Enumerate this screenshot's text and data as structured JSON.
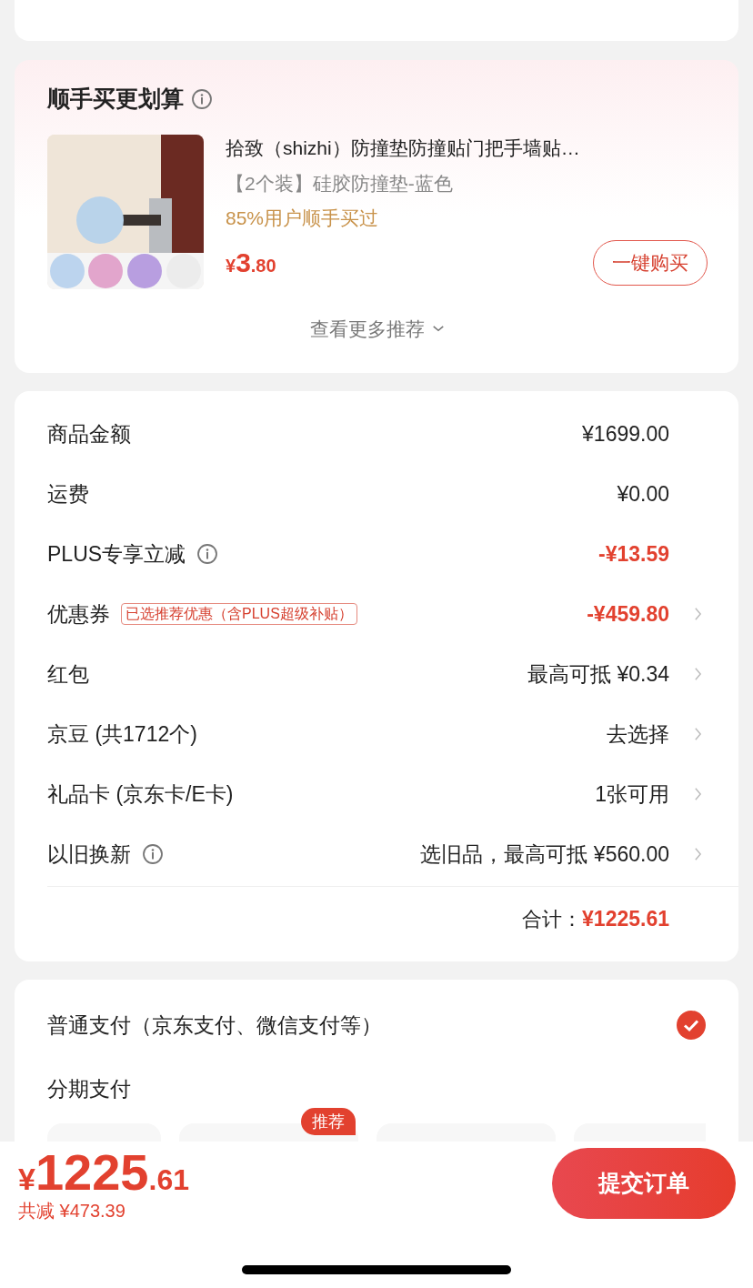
{
  "bundle": {
    "title": "顺手买更划算",
    "info": true,
    "product": {
      "title": "拾致（shizhi）防撞垫防撞贴门把手墙贴…",
      "spec": "【2个装】硅胶防撞垫-蓝色",
      "social": "85%用户顺手买过",
      "price": {
        "currency": "¥",
        "integer": "3",
        "decimal": ".80"
      },
      "button": "一键购买"
    },
    "more": "查看更多推荐"
  },
  "summary": {
    "rows": [
      {
        "label": "商品金额",
        "info": false,
        "value": "¥1699.00",
        "kind": "plain",
        "chevron": false
      },
      {
        "label": "运费",
        "info": false,
        "value": "¥0.00",
        "kind": "plain",
        "chevron": false
      },
      {
        "label": "PLUS专享立减",
        "info": true,
        "value": "-¥13.59",
        "kind": "discount",
        "chevron": false
      },
      {
        "label": "优惠券",
        "info": false,
        "tag": "已选推荐优惠（含PLUS超级补贴）",
        "value": "-¥459.80",
        "kind": "discount",
        "chevron": true
      },
      {
        "label": "红包",
        "info": false,
        "value": "最高可抵 ¥0.34",
        "kind": "plain",
        "chevron": true
      },
      {
        "label": "京豆 (共1712个)",
        "info": false,
        "value": "去选择",
        "kind": "plain",
        "chevron": true
      },
      {
        "label": "礼品卡 (京东卡/E卡)",
        "info": false,
        "value": "1张可用",
        "kind": "plain",
        "chevron": true
      },
      {
        "label": "以旧换新",
        "info": true,
        "value": "选旧品，最高可抵 ¥560.00",
        "kind": "plain",
        "chevron": true
      }
    ],
    "total_label": "合计：",
    "total_value": "¥1225.61"
  },
  "payment": {
    "options": [
      {
        "label": "普通支付（京东支付、微信支付等）",
        "selected": true
      }
    ],
    "installment": {
      "label": "分期支付",
      "badge": "推荐"
    }
  },
  "bottom_bar": {
    "price": {
      "currency": "¥",
      "integer": "1225",
      "decimal": ".61"
    },
    "saved": "共减 ¥473.39",
    "submit": "提交订单"
  }
}
